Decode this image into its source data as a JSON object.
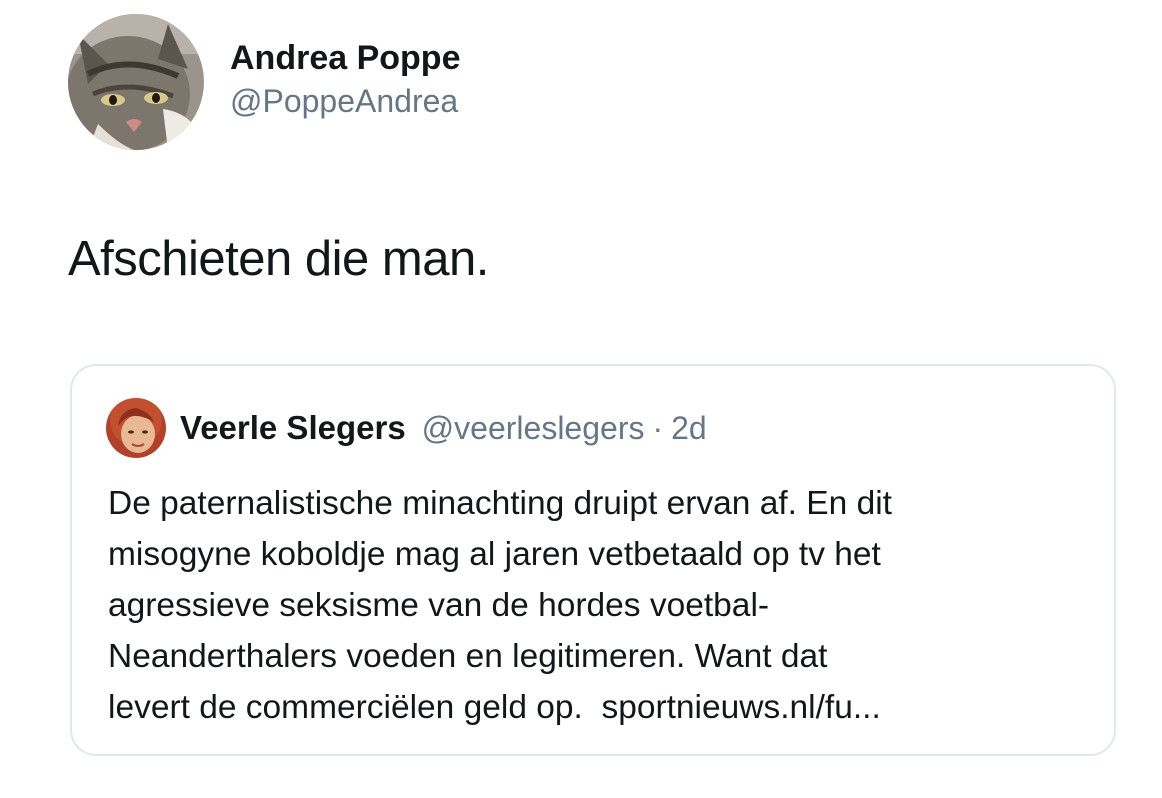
{
  "tweet": {
    "author": {
      "display_name": "Andrea Poppe",
      "handle": "@PoppeAndrea",
      "avatar_icon": "cat-photo-avatar"
    },
    "text": "Afschieten die man.",
    "quoted": {
      "author": {
        "display_name": "Veerle Slegers",
        "handle": "@veerleslegers",
        "separator": "·",
        "time": "2d",
        "avatar_icon": "person-photo-avatar"
      },
      "lines": [
        "De paternalistische minachting druipt ervan af. En dit",
        "misogyne koboldje mag al jaren vetbetaald op tv het",
        "agressieve seksisme van de hordes voetbal-",
        "Neanderthalers voeden en legitimeren. Want dat",
        "levert de commerciëlen geld op."
      ],
      "link": "sportnieuws.nl/fu..."
    }
  },
  "colors": {
    "text": "#14171a",
    "secondary": "#657786",
    "border": "#e1e8ed"
  }
}
